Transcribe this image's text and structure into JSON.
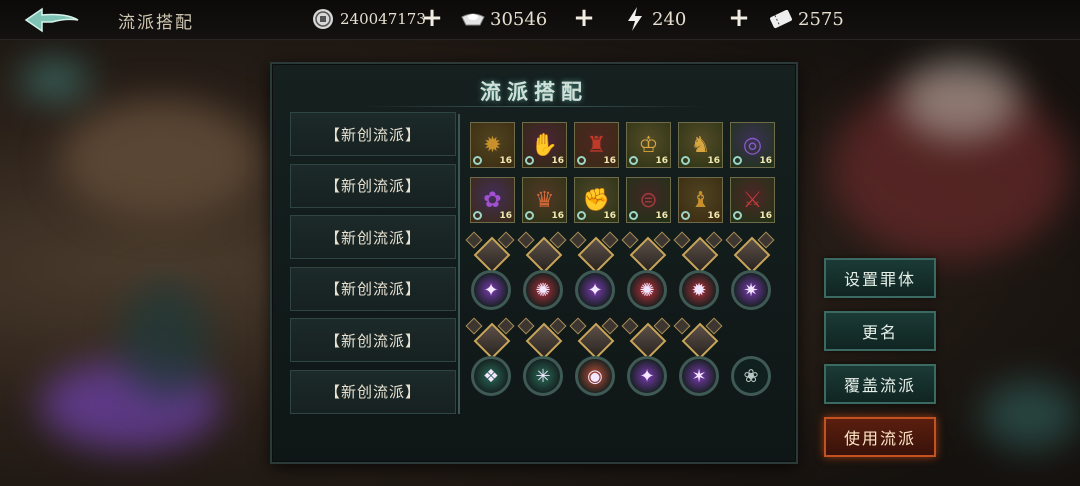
{
  "topbar": {
    "title": "流派搭配",
    "resources": [
      {
        "icon": "coin-icon",
        "value": "240047173"
      },
      {
        "icon": "silver-ingot-icon",
        "value": "30546"
      },
      {
        "icon": "lightning-icon",
        "value": "240"
      },
      {
        "icon": "ticket-icon",
        "value": "2575"
      }
    ]
  },
  "panel": {
    "title": "流派搭配",
    "loadouts": [
      "【新创流派】",
      "【新创流派】",
      "【新创流派】",
      "【新创流派】",
      "【新创流派】",
      "【新创流派】"
    ]
  },
  "equipment": [
    {
      "name": "equip-fan",
      "level": "16",
      "color": "#c8902a",
      "glyph": "✹",
      "bg": "#3b2c10"
    },
    {
      "name": "equip-claw",
      "level": "16",
      "color": "#c0306a",
      "glyph": "✋",
      "bg": "#2e2a10"
    },
    {
      "name": "equip-armor-red",
      "level": "16",
      "color": "#c03a2a",
      "glyph": "♜",
      "bg": "#3a2a14"
    },
    {
      "name": "equip-helm-gold",
      "level": "16",
      "color": "#d7a640",
      "glyph": "♔",
      "bg": "#2c3414"
    },
    {
      "name": "equip-boots-gold",
      "level": "16",
      "color": "#d7a640",
      "glyph": "♞",
      "bg": "#2c3414"
    },
    {
      "name": "equip-ring-purple",
      "level": "16",
      "color": "#8a5ac8",
      "glyph": "◎",
      "bg": "#1f3316"
    },
    {
      "name": "equip-lotus-purple",
      "level": "16",
      "color": "#a050d0",
      "glyph": "✿",
      "bg": "#3a2a12"
    },
    {
      "name": "equip-headdress",
      "level": "16",
      "color": "#d06a3a",
      "glyph": "♛",
      "bg": "#2c3414"
    },
    {
      "name": "equip-gauntlet",
      "level": "16",
      "color": "#c89a4a",
      "glyph": "✊",
      "bg": "#2a3214"
    },
    {
      "name": "equip-belt",
      "level": "16",
      "color": "#a03a3a",
      "glyph": "⊜",
      "bg": "#1f3316"
    },
    {
      "name": "equip-horned-helm",
      "level": "16",
      "color": "#c8902a",
      "glyph": "♝",
      "bg": "#3a2a10"
    },
    {
      "name": "equip-blade",
      "level": "16",
      "color": "#c03a3a",
      "glyph": "⚔",
      "bg": "#1f3316"
    }
  ],
  "team": [
    {
      "orb_color": "#7a3ab0",
      "orb_glyph": "✦"
    },
    {
      "orb_color": "#b0303a",
      "orb_glyph": "✺"
    },
    {
      "orb_color": "#7a3ab0",
      "orb_glyph": "✦"
    },
    {
      "orb_color": "#c0303a",
      "orb_glyph": "✺"
    },
    {
      "orb_color": "#b0303a",
      "orb_glyph": "✹"
    },
    {
      "orb_color": "#7a3ab0",
      "orb_glyph": "✷"
    },
    {
      "orb_color": "#2a6a58",
      "orb_glyph": "❖"
    },
    {
      "orb_color": "#2a6a58",
      "orb_glyph": "✳"
    },
    {
      "orb_color": "#c0503a",
      "orb_glyph": "◉"
    },
    {
      "orb_color": "#7a3ab0",
      "orb_glyph": "✦"
    },
    {
      "orb_color": "#7a3ab0",
      "orb_glyph": "✶"
    },
    {
      "orb_color": "empty",
      "orb_glyph": "❀"
    }
  ],
  "buttons": {
    "set_relic": "设置罪体",
    "rename": "更名",
    "overwrite": "覆盖流派",
    "use": "使用流派"
  }
}
